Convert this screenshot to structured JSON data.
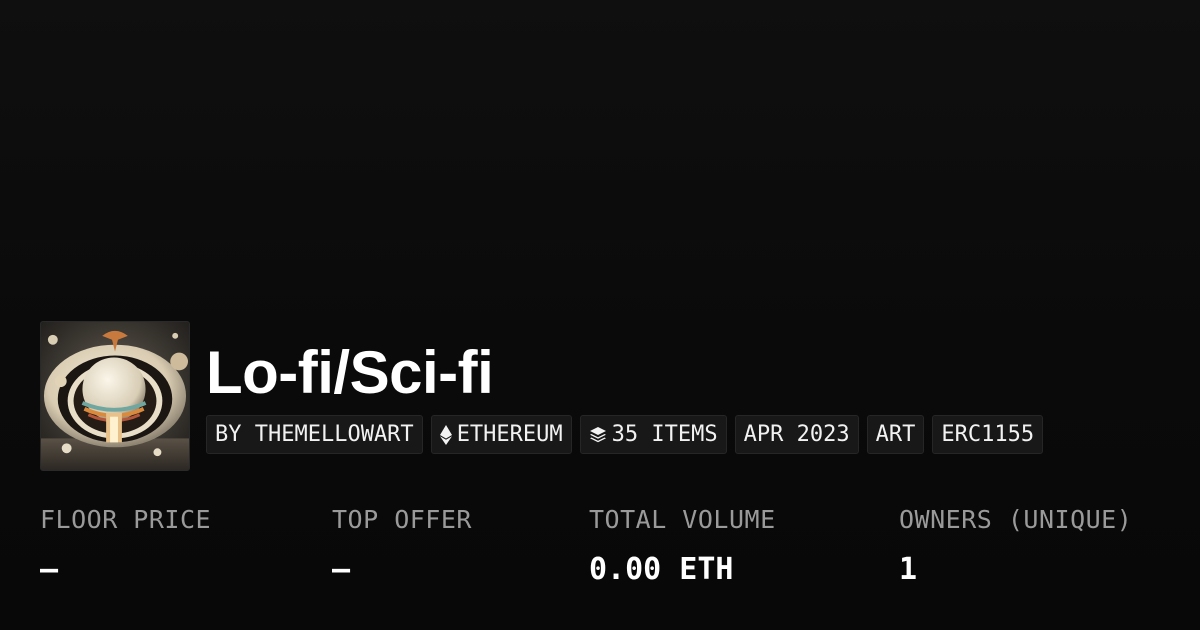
{
  "collection": {
    "title": "Lo-fi/Sci-fi",
    "avatar_alt": "collection artwork"
  },
  "pills": [
    {
      "label": "BY THEMELLOWART",
      "icon": ""
    },
    {
      "label": "ETHEREUM",
      "icon": "ethereum-icon"
    },
    {
      "label": "35 ITEMS",
      "icon": "layers-icon"
    },
    {
      "label": "APR 2023",
      "icon": ""
    },
    {
      "label": "ART",
      "icon": ""
    },
    {
      "label": "ERC1155",
      "icon": ""
    }
  ],
  "stats": [
    {
      "label": "FLOOR PRICE",
      "value": "–"
    },
    {
      "label": "TOP OFFER",
      "value": "–"
    },
    {
      "label": "TOTAL VOLUME",
      "value": "0.00 ETH"
    },
    {
      "label": "OWNERS (UNIQUE)",
      "value": "1"
    }
  ],
  "colors": {
    "background": "#0b0b0b",
    "pill_background": "#181818",
    "label_gray": "#9a9a9a",
    "text": "#ffffff"
  }
}
